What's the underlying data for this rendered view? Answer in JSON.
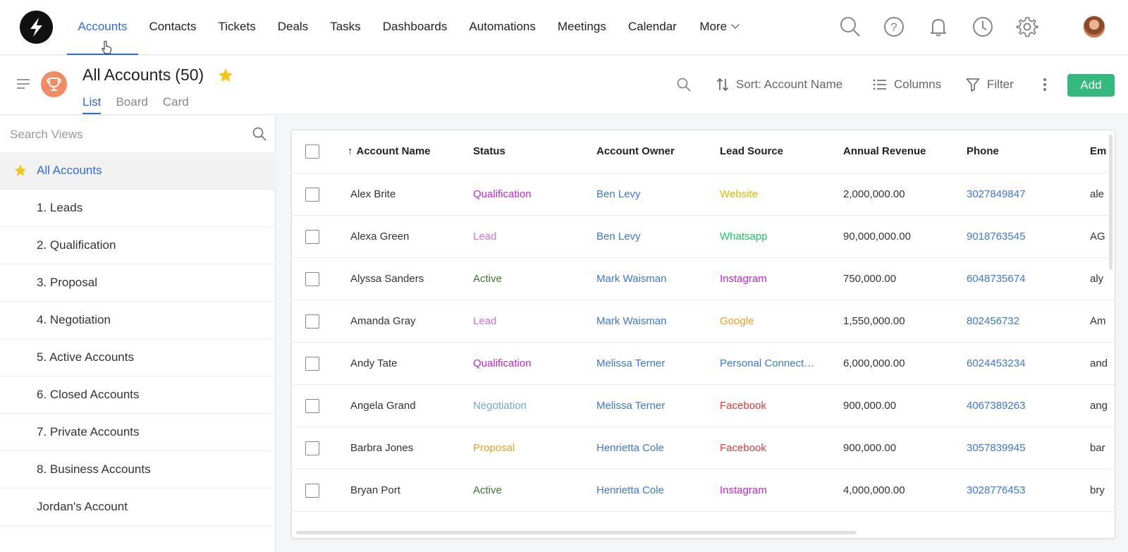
{
  "nav": {
    "items": [
      {
        "label": "Accounts",
        "active": true
      },
      {
        "label": "Contacts"
      },
      {
        "label": "Tickets"
      },
      {
        "label": "Deals"
      },
      {
        "label": "Tasks"
      },
      {
        "label": "Dashboards"
      },
      {
        "label": "Automations"
      },
      {
        "label": "Meetings"
      },
      {
        "label": "Calendar"
      }
    ],
    "more_label": "More",
    "icons": [
      "search-icon",
      "help-icon",
      "bell-icon",
      "clock-icon",
      "gear-icon",
      "avatar"
    ]
  },
  "header": {
    "title": "All Accounts",
    "count": "(50)",
    "view_tabs": [
      {
        "label": "List",
        "active": true
      },
      {
        "label": "Board"
      },
      {
        "label": "Card"
      }
    ],
    "sort_label": "Sort: Account Name",
    "columns_label": "Columns",
    "filter_label": "Filter",
    "add_label": "Add"
  },
  "sidebar": {
    "search_placeholder": "Search Views",
    "views": [
      {
        "label": "All Accounts",
        "active": true,
        "starred": true
      },
      {
        "label": "1. Leads"
      },
      {
        "label": "2. Qualification"
      },
      {
        "label": "3. Proposal"
      },
      {
        "label": "4. Negotiation"
      },
      {
        "label": "5. Active Accounts"
      },
      {
        "label": "6. Closed Accounts"
      },
      {
        "label": "7. Private Accounts"
      },
      {
        "label": "8. Business Accounts"
      },
      {
        "label": "Jordan's Account"
      }
    ]
  },
  "table": {
    "columns": [
      "Account Name",
      "Status",
      "Account Owner",
      "Lead Source",
      "Annual Revenue",
      "Phone",
      "Em"
    ],
    "sort_arrow": "↑",
    "rows": [
      {
        "name": "Alex Brite",
        "status": "Qualification",
        "owner": "Ben Levy",
        "source": "Website",
        "revenue": "2,000,000.00",
        "phone": "3027849847",
        "email": "ale"
      },
      {
        "name": "Alexa Green",
        "status": "Lead",
        "owner": "Ben Levy",
        "source": "Whatsapp",
        "revenue": "90,000,000.00",
        "phone": "9018763545",
        "email": "AG"
      },
      {
        "name": "Alyssa Sanders",
        "status": "Active",
        "owner": "Mark Waisman",
        "source": "Instagram",
        "revenue": "750,000.00",
        "phone": "6048735674",
        "email": "aly"
      },
      {
        "name": "Amanda Gray",
        "status": "Lead",
        "owner": "Mark Waisman",
        "source": "Google",
        "revenue": "1,550,000.00",
        "phone": "802456732",
        "email": "Am"
      },
      {
        "name": "Andy Tate",
        "status": "Qualification",
        "owner": "Melissa Terner",
        "source": "Personal Connect…",
        "revenue": "6,000,000.00",
        "phone": "6024453234",
        "email": "and"
      },
      {
        "name": "Angela Grand",
        "status": "Negotiation",
        "owner": "Melissa Terner",
        "source": "Facebook",
        "revenue": "900,000.00",
        "phone": "4067389263",
        "email": "ang"
      },
      {
        "name": "Barbra Jones",
        "status": "Proposal",
        "owner": "Henrietta Cole",
        "source": "Facebook",
        "revenue": "900,000.00",
        "phone": "3057839945",
        "email": "bar"
      },
      {
        "name": "Bryan Port",
        "status": "Active",
        "owner": "Henrietta Cole",
        "source": "Instagram",
        "revenue": "4,000,000.00",
        "phone": "3028776453",
        "email": "bry"
      }
    ]
  },
  "colors": {
    "accent": "#2d6be0",
    "add_button": "#34b87c",
    "status": {
      "Qualification": "#c026d3",
      "Lead": "#d46fd6",
      "Active": "#3b7a2a",
      "Negotiation": "#6fa8dc",
      "Proposal": "#f0a020"
    },
    "source": {
      "Website": "#e6b800",
      "Whatsapp": "#1fc760",
      "Instagram": "#c026d3",
      "Google": "#f0a020",
      "Personal Connect…": "#3b78dd",
      "Facebook": "#e53935"
    }
  }
}
